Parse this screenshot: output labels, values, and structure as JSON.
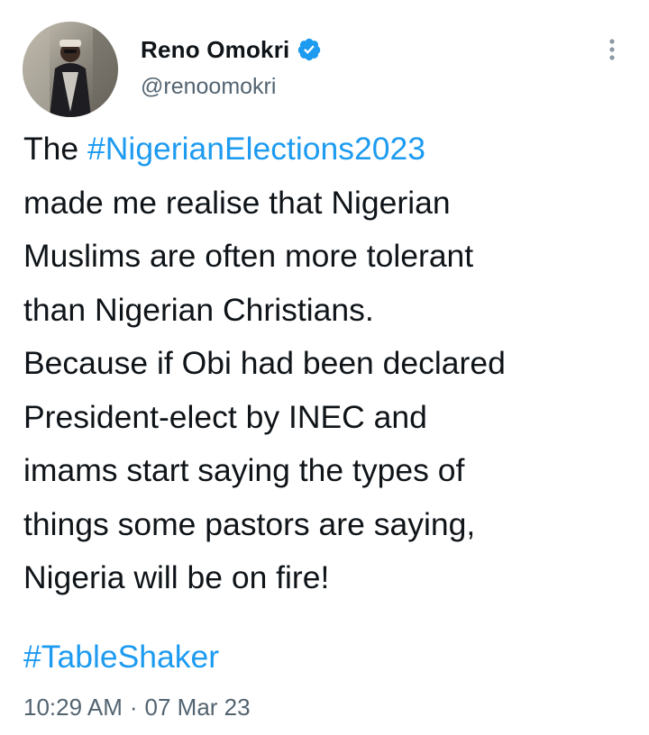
{
  "author": {
    "display_name": "Reno Omokri",
    "handle": "@renoomokri",
    "verified": true
  },
  "tweet": {
    "hashtag_main": "#NigerianElections2023",
    "text_prefix": "The ",
    "lines": [
      "made me realise that Nigerian",
      "Muslims are often more tolerant",
      "than Nigerian Christians.",
      "Because if Obi had been declared",
      "President-elect by INEC and",
      "imams start saying the types of",
      "things some pastors are saying,",
      "Nigeria will be on fire!"
    ],
    "hashtag_footer": "#TableShaker",
    "time": "10:29 AM",
    "separator": "·",
    "date": "07 Mar 23"
  },
  "colors": {
    "link": "#1d9bf0",
    "text": "#0f1419",
    "muted": "#536471"
  },
  "icons": {
    "verified": "verified-badge-icon",
    "more": "more-options-icon"
  }
}
